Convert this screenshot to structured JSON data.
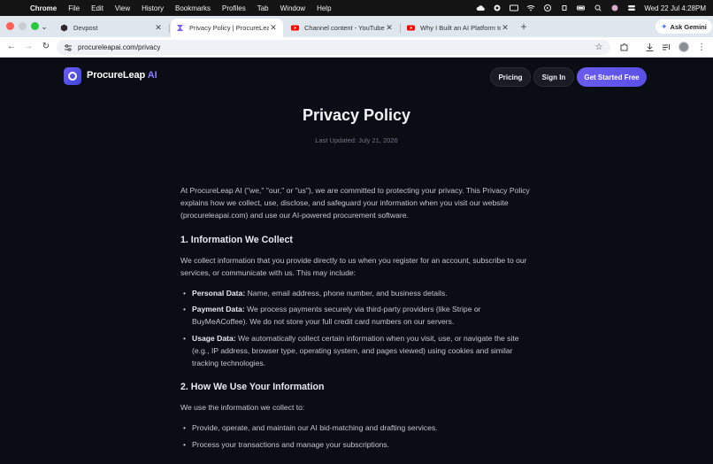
{
  "menubar": {
    "app": "Chrome",
    "items": [
      "File",
      "Edit",
      "View",
      "History",
      "Bookmarks",
      "Profiles",
      "Tab",
      "Window",
      "Help"
    ],
    "clock": "Wed 22 Jul  4:28PM"
  },
  "tabs": [
    {
      "title": "Devpost",
      "icon": "devpost-icon",
      "active": false
    },
    {
      "title": "Privacy Policy | ProcureLeap AI",
      "icon": "procureleap-favicon",
      "active": true
    },
    {
      "title": "Channel content - YouTube Studio",
      "icon": "youtube-icon",
      "active": false
    },
    {
      "title": "Why I Built an AI Platform to Save",
      "icon": "youtube-icon",
      "active": false
    }
  ],
  "ask_gemini": "Ask Gemini",
  "toolbar": {
    "url": "procureleapai.com/privacy"
  },
  "site": {
    "brand": "ProcureLeap",
    "brand_suffix": "AI",
    "nav": {
      "pricing": "Pricing",
      "sign_in": "Sign In",
      "cta": "Get Started Free"
    },
    "title": "Privacy Policy",
    "updated": "Last Updated: July 21, 2026",
    "intro": "At ProcureLeap AI (\"we,\" \"our,\" or \"us\"), we are committed to protecting your privacy. This Privacy Policy explains how we collect, use, disclose, and safeguard your information when you visit our website (procureleapai.com) and use our AI-powered procurement software.",
    "section1": {
      "heading": "1. Information We Collect",
      "lead": "We collect information that you provide directly to us when you register for an account, subscribe to our services, or communicate with us. This may include:",
      "items": [
        {
          "label": "Personal Data:",
          "text": " Name, email address, phone number, and business details."
        },
        {
          "label": "Payment Data:",
          "text": " We process payments securely via third-party providers (like Stripe or BuyMeACoffee). We do not store your full credit card numbers on our servers."
        },
        {
          "label": "Usage Data:",
          "text": " We automatically collect certain information when you visit, use, or navigate the site (e.g., IP address, browser type, operating system, and pages viewed) using cookies and similar tracking technologies."
        }
      ]
    },
    "section2": {
      "heading": "2. How We Use Your Information",
      "lead": "We use the information we collect to:",
      "items": [
        "Provide, operate, and maintain our AI bid-matching and drafting services.",
        "Process your transactions and manage your subscriptions."
      ]
    }
  },
  "colors": {
    "page_bg": "#0b0d14",
    "accent": "#6c5cf0",
    "brand_ai": "#8b7dff"
  }
}
